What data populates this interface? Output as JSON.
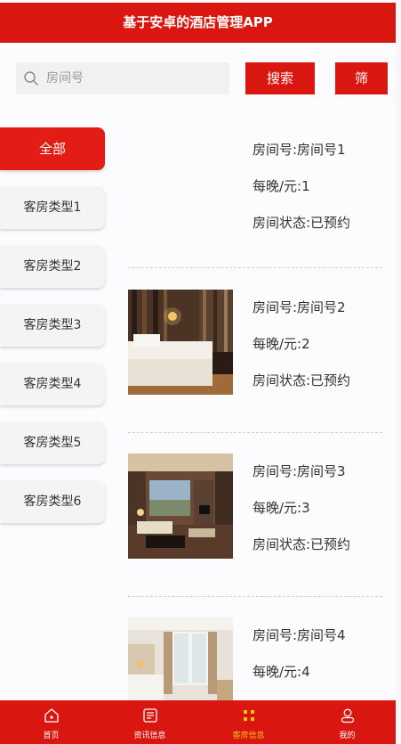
{
  "header": {
    "title": "基于安卓的酒店管理APP"
  },
  "search": {
    "placeholder": "房间号",
    "value": "",
    "button_label": "搜索",
    "filter_label": "筛"
  },
  "categories": [
    {
      "label": "全部",
      "active": true
    },
    {
      "label": "客房类型1"
    },
    {
      "label": "客房类型2"
    },
    {
      "label": "客房类型3"
    },
    {
      "label": "客房类型4"
    },
    {
      "label": "客房类型5"
    },
    {
      "label": "客房类型6"
    }
  ],
  "rooms": [
    {
      "room_no": "房间号:房间号1",
      "price": "每晚/元:1",
      "status": "房间状态:已预约",
      "image": "none"
    },
    {
      "room_no": "房间号:房间号2",
      "price": "每晚/元:2",
      "status": "房间状态:已预约",
      "image": "bedroom-warm-photo"
    },
    {
      "room_no": "房间号:房间号3",
      "price": "每晚/元:3",
      "status": "房间状态:已预约",
      "image": "suite-living-photo"
    },
    {
      "room_no": "房间号:房间号4",
      "price": "每晚/元:4",
      "status": "",
      "image": "bright-room-photo"
    }
  ],
  "tabbar": {
    "items": [
      {
        "label": "首页",
        "icon": "home-icon"
      },
      {
        "label": "资讯信息",
        "icon": "news-icon"
      },
      {
        "label": "客房信息",
        "icon": "grid-icon",
        "active": true
      },
      {
        "label": "我的",
        "icon": "user-icon"
      }
    ]
  },
  "colors": {
    "primary": "#d9160f",
    "active_tab": "#f2c515"
  }
}
